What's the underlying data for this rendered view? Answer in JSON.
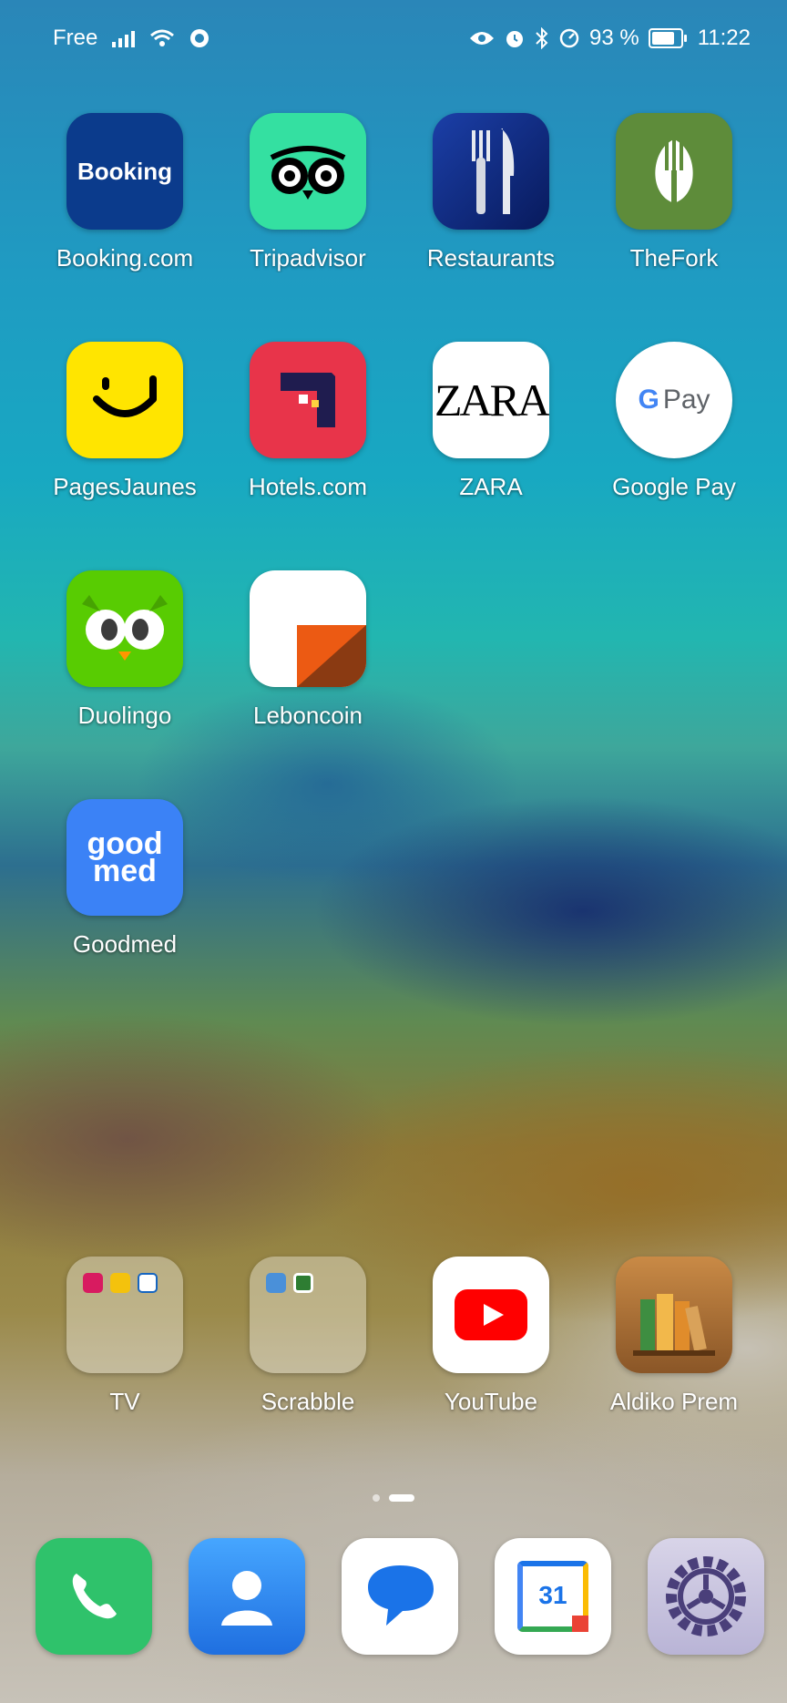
{
  "status_bar": {
    "carrier": "Free",
    "battery": "93 %",
    "battery_level": 0.93,
    "time": "11:22"
  },
  "apps": {
    "booking": {
      "label": "Booking.com",
      "icon_text": "Booking"
    },
    "tripadvisor": {
      "label": "Tripadvisor"
    },
    "restaurants": {
      "label": "Restaurants"
    },
    "thefork": {
      "label": "TheFork"
    },
    "pagesjaunes": {
      "label": "PagesJaunes"
    },
    "hotels": {
      "label": "Hotels.com"
    },
    "zara": {
      "label": "ZARA",
      "icon_text": "ZARA"
    },
    "googlepay": {
      "label": "Google Pay",
      "icon_g": "G",
      "icon_text": "Pay"
    },
    "duolingo": {
      "label": "Duolingo"
    },
    "leboncoin": {
      "label": "Leboncoin"
    },
    "goodmed": {
      "label": "Goodmed",
      "icon_line1": "good",
      "icon_line2": "med"
    },
    "tv_folder": {
      "label": "TV"
    },
    "scrabble_folder": {
      "label": "Scrabble"
    },
    "youtube": {
      "label": "YouTube"
    },
    "aldiko": {
      "label": "Aldiko Prem"
    }
  },
  "dock": {
    "phone": "phone-icon",
    "contacts": "contacts-icon",
    "messages": "messages-icon",
    "calendar": {
      "icon": "calendar-icon",
      "day": "31"
    },
    "settings": "settings-gear-icon"
  },
  "colors": {
    "booking": "#0b3b8c",
    "tripadvisor": "#34e0a1",
    "thefork": "#5e8c3a",
    "pagesjaunes": "#ffe500",
    "hotels": "#e8344a",
    "duolingo": "#58cc02",
    "goodmed": "#3b82f6",
    "youtube": "#ff0000",
    "phone": "#2fc26b",
    "contacts": "#2e8ef7"
  }
}
